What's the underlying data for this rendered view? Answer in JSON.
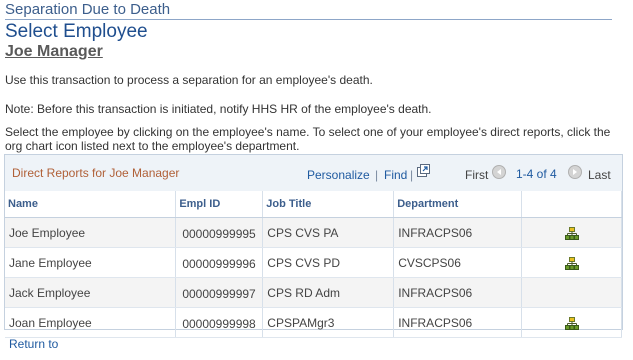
{
  "breadcrumb_title": "Separation Due to Death",
  "page_title": "Select Employee",
  "manager_name": "Joe Manager",
  "instructions": {
    "line1": "Use this transaction to process a separation for an employee's death.",
    "line2": "Note: Before this transaction is initiated, notify HHS HR of the employee's death.",
    "line3": "Select the employee by clicking on the employee's name. To select one of your employee's direct reports, click the org chart icon listed next to the employee's department."
  },
  "grid": {
    "title": "Direct Reports for Joe Manager",
    "personalize": "Personalize",
    "find": "Find",
    "separator": "|",
    "first": "First",
    "range": "1-4 of 4",
    "last": "Last",
    "columns": [
      "Name",
      "Empl ID",
      "Job Title",
      "Department"
    ],
    "rows": [
      {
        "name": "Joe Employee",
        "empl_id": "00000999995",
        "job_title": "CPS CVS PA",
        "department": "INFRACPS06",
        "org_icon": true
      },
      {
        "name": "Jane Employee",
        "empl_id": "00000999996",
        "job_title": "CPS CVS PD",
        "department": "CVSCPS06",
        "org_icon": true
      },
      {
        "name": "Jack Employee",
        "empl_id": "00000999997",
        "job_title": "CPS RD Adm",
        "department": "INFRACPS06",
        "org_icon": false
      },
      {
        "name": "Joan Employee",
        "empl_id": "00000999998",
        "job_title": "CPSPAMgr3",
        "department": "INFRACPS06",
        "org_icon": true
      }
    ]
  },
  "return_link": "Return to",
  "colors": {
    "title_blue": "#1f4e8e",
    "link_blue": "#1f5aa0",
    "grid_title": "#b06038",
    "org_icon_green": "#6a9a2a",
    "org_icon_yellow": "#e8c020"
  },
  "icons": {
    "view_all": "view-all-icon",
    "prev": "previous-arrow-icon",
    "next": "next-arrow-icon",
    "org_chart": "org-chart-icon"
  }
}
